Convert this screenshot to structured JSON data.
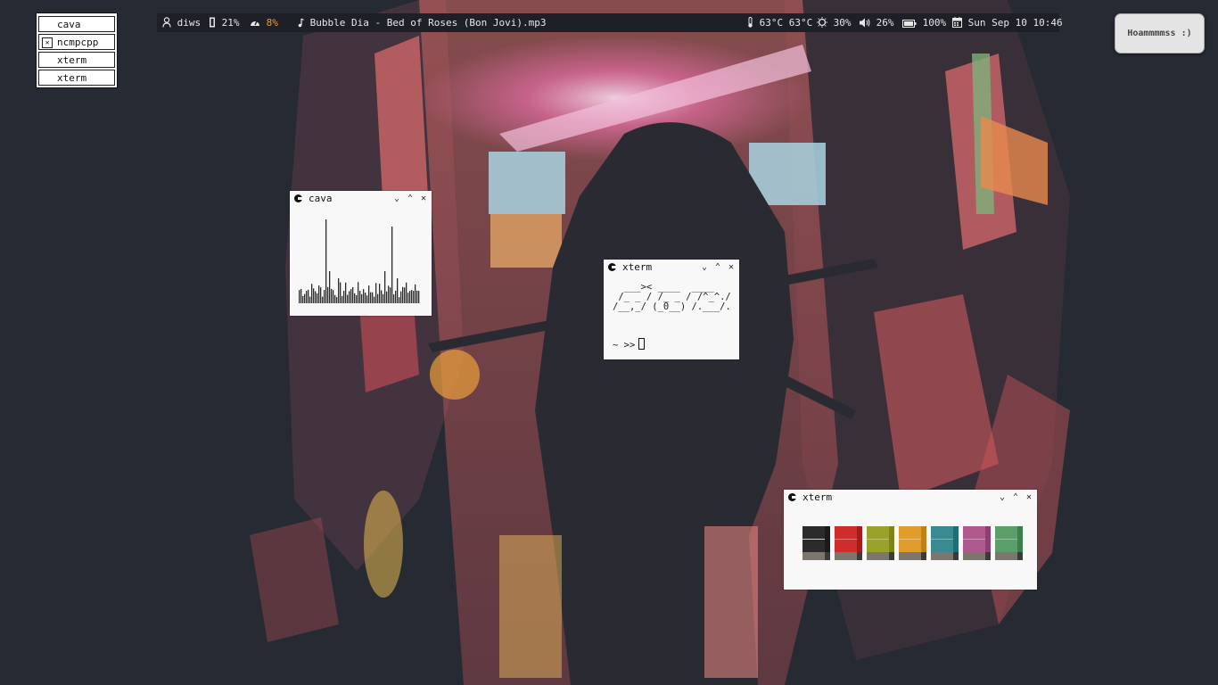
{
  "tasklist": {
    "items": [
      {
        "label": "cava",
        "icon": ""
      },
      {
        "label": "ncmpcpp",
        "icon": "x-box-icon"
      },
      {
        "label": "xterm",
        "icon": ""
      },
      {
        "label": "xterm",
        "icon": ""
      }
    ]
  },
  "topbar": {
    "workspace": "diws",
    "memory": "21%",
    "cpu": "8%",
    "song": "Bubble Dia - Bed of Roses (Bon Jovi).mp3",
    "temperature": "63°C 63°C",
    "brightness": "30%",
    "volume": "26%",
    "battery": "100%",
    "datetime": "Sun Sep 10 10:46"
  },
  "notification": {
    "text": "Hoammmmss :)"
  },
  "windows": {
    "cava": {
      "title": "cava"
    },
    "xterm_ascii": {
      "title": "xterm",
      "ascii": "  ___>< ____  ____\n /_ _ / /_ _ / /^_^./\n/__,_/ (_0__) /.___/.",
      "prompt": "~ >>"
    },
    "xterm_colors": {
      "title": "xterm"
    }
  },
  "colors": {
    "bar_bg": "#1e2027",
    "accent_orange": "#e89b3c",
    "swatches": [
      "#2b2b2b",
      "#cf2c2c",
      "#9aa22a",
      "#e09d2b",
      "#3a8a92",
      "#b0598e",
      "#5c9e69"
    ],
    "swatch_stripes": [
      "#1a1a1a",
      "#a31d1d",
      "#7d8418",
      "#c27f16",
      "#1f6d75",
      "#8f3f71",
      "#3e7d4d"
    ]
  }
}
